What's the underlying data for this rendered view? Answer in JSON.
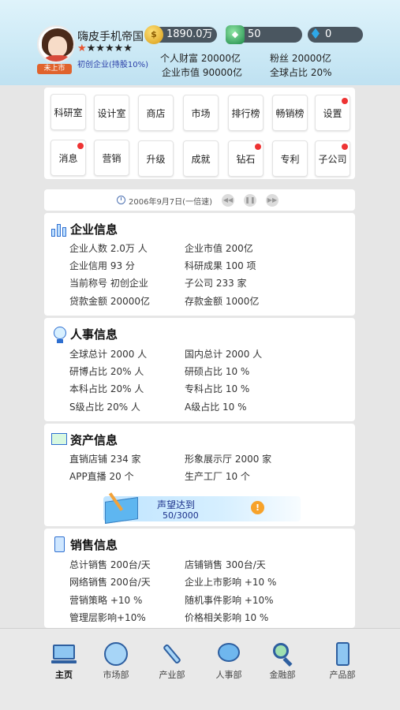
{
  "header": {
    "company_name": "嗨皮手机帝国",
    "listed_status": "未上市",
    "company_tag": "初创企业(持股10%)",
    "stars_lit": 1,
    "stars_total": 6,
    "coins": "1890.0万",
    "gems": "50",
    "diamonds": "0",
    "personal_wealth": "个人财富 20000亿",
    "fans": "粉丝 20000亿",
    "market_value": "企业市值 90000亿",
    "global_share": "全球占比 20%"
  },
  "menu": {
    "row1": [
      {
        "label": "科研室",
        "dot": false
      },
      {
        "label": "设计室",
        "dot": false
      },
      {
        "label": "商店",
        "dot": false
      },
      {
        "label": "市场",
        "dot": false
      },
      {
        "label": "排行榜",
        "dot": false
      },
      {
        "label": "畅销榜",
        "dot": false
      },
      {
        "label": "设置",
        "dot": true
      }
    ],
    "row2": [
      {
        "label": "消息",
        "dot": true
      },
      {
        "label": "营销",
        "dot": false
      },
      {
        "label": "升级",
        "dot": false
      },
      {
        "label": "成就",
        "dot": false
      },
      {
        "label": "钻石",
        "dot": true
      },
      {
        "label": "专利",
        "dot": false
      },
      {
        "label": "子公司",
        "dot": true
      }
    ]
  },
  "time_bar": {
    "date_text": "2006年9月7日(一倍速)"
  },
  "enterprise": {
    "title": "企业信息",
    "items": [
      "企业人数  2.0万 人",
      "企业市值  200亿",
      "企业信用  93 分",
      "科研成果  100 项",
      "当前称号  初创企业",
      "子公司  233 家",
      "贷款金额  20000亿",
      "存款金额  1000亿"
    ]
  },
  "personnel": {
    "title": "人事信息",
    "items": [
      "全球总计  2000 人",
      "国内总计  2000 人",
      "研博占比  20% 人",
      "研硕占比  10 %",
      "本科占比  20% 人",
      "专科占比  10 %",
      "S级占比  20% 人",
      "A级占比  10 %"
    ]
  },
  "assets": {
    "title": "资产信息",
    "items": [
      "直销店铺  234 家",
      "形象展示厅  2000 家",
      "APP直播  20 个",
      "生产工厂  10 个"
    ],
    "reputation_label": "声望达到",
    "reputation_value": "50/3000"
  },
  "sales": {
    "title": "销售信息",
    "items": [
      "总计销售  200台/天",
      "店铺销售  300台/天",
      "网络销售  200台/天",
      "企业上市影响  +10 %",
      "营销策略  +10 %",
      "随机事件影响  +10%",
      "管理层影响+10%",
      "价格相关影响  10 %"
    ]
  },
  "bottom_nav": [
    {
      "label": "主页",
      "icon": "laptop-icon"
    },
    {
      "label": "市场部",
      "icon": "chart-disc-icon"
    },
    {
      "label": "产业部",
      "icon": "wrench-icon"
    },
    {
      "label": "人事部",
      "icon": "chat-bubble-icon"
    },
    {
      "label": "金融部",
      "icon": "magnifier-icon"
    },
    {
      "label": "产品部",
      "icon": "phone-icon"
    }
  ],
  "colors": {
    "header_bg": "#cdeaf6",
    "accent_blue": "#2e6fd0",
    "badge_orange": "#e0632d",
    "red_dot": "#ee3333",
    "panel_bg": "#ffffff",
    "page_bg": "#e6e6e6"
  }
}
